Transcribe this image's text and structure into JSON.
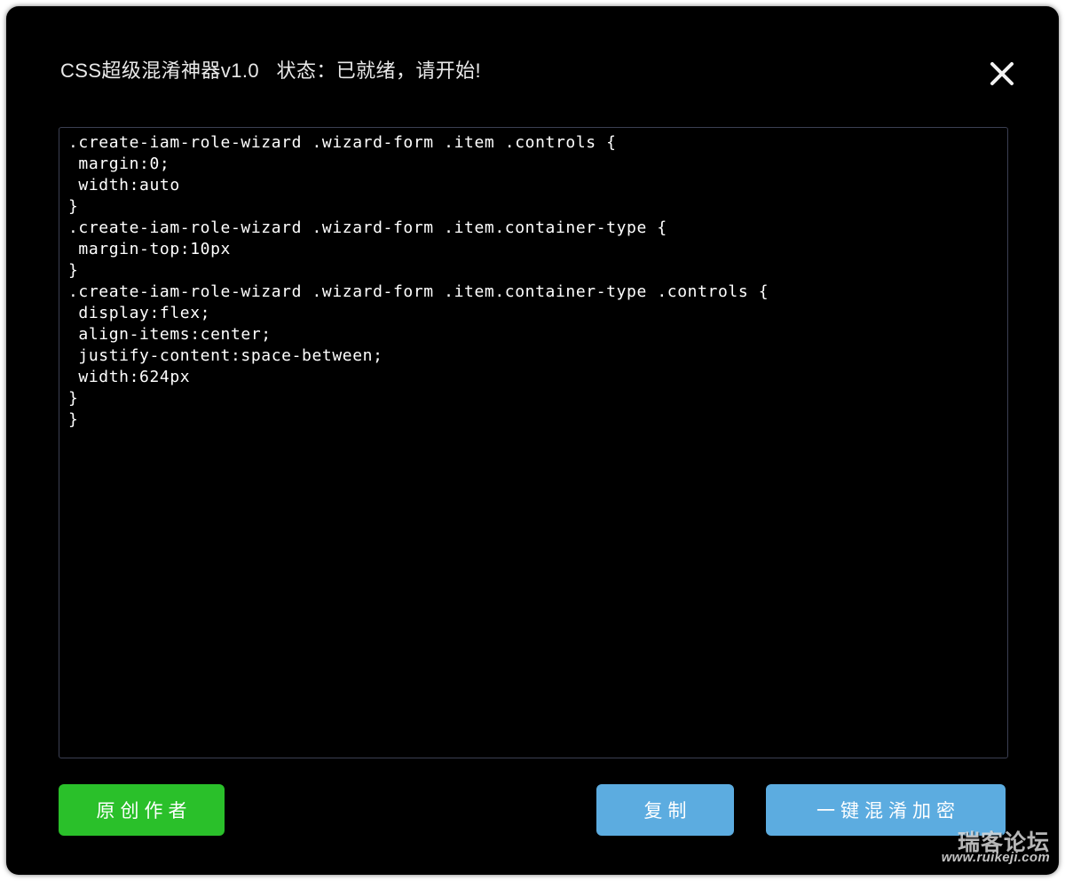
{
  "window": {
    "title": "CSS超级混淆神器v1.0   状态：已就绪，请开始!",
    "app_name": "CSS超级混淆神器v1.0",
    "status_label": "状态：",
    "status_value": "已就绪，请开始!",
    "close_icon": "close-icon"
  },
  "editor": {
    "placeholder": "",
    "value": ".create-iam-role-wizard .wizard-form .item .controls {\n margin:0;\n width:auto\n}\n.create-iam-role-wizard .wizard-form .item.container-type {\n margin-top:10px\n}\n.create-iam-role-wizard .wizard-form .item.container-type .controls {\n display:flex;\n align-items:center;\n justify-content:space-between;\n width:624px\n}\n}",
    "lines": [
      ".create-iam-role-wizard .wizard-form .item .controls {",
      " margin:0;",
      " width:auto",
      "}",
      ".create-iam-role-wizard .wizard-form .item.container-type {",
      " margin-top:10px",
      "}",
      ".create-iam-role-wizard .wizard-form .item.container-type .controls {",
      " display:flex;",
      " align-items:center;",
      " justify-content:space-between;",
      " width:624px",
      "}"
    ]
  },
  "footer": {
    "author_label": "原创作者",
    "copy_label": "复制",
    "obfuscate_label": "一键混淆加密"
  },
  "watermark": {
    "cn": "瑞客论坛",
    "url": "www.ruikeji.com"
  },
  "colors": {
    "window_bg": "#000000",
    "page_bg": "#ffffff",
    "accent_green": "#2ac02a",
    "accent_blue": "#5cace0",
    "border": "#3b3f52",
    "text": "#ffffff"
  }
}
